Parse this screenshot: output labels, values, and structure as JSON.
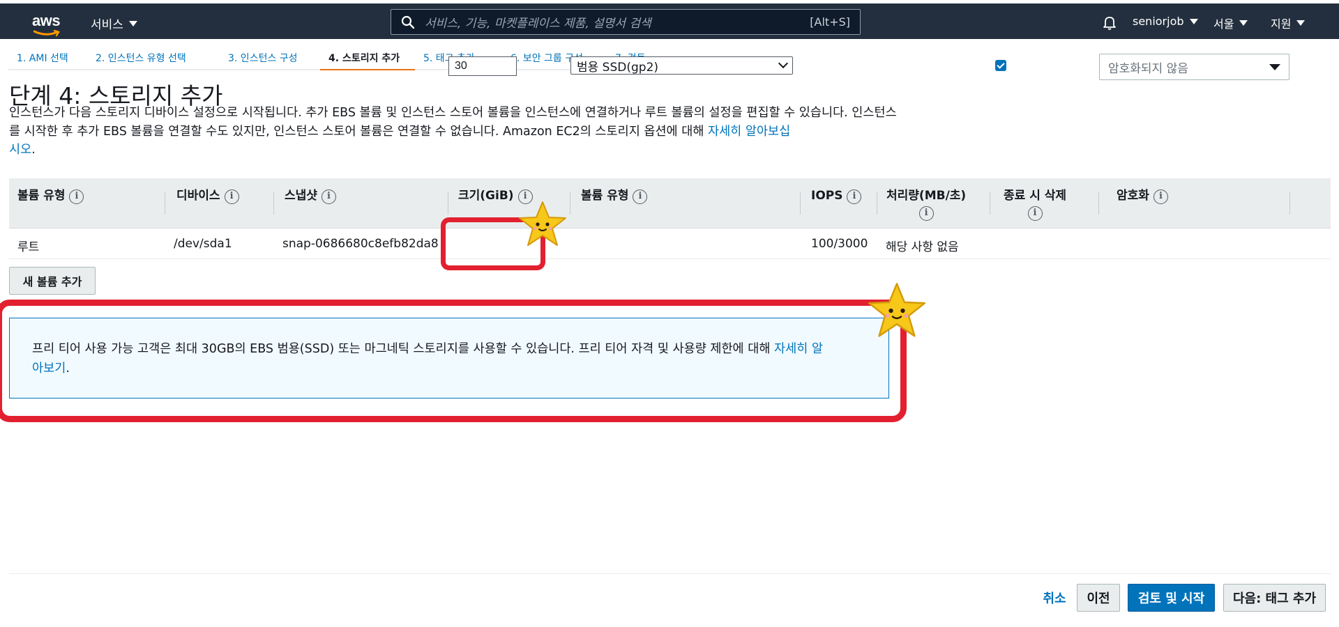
{
  "nav": {
    "logo_text": "aws",
    "services_label": "서비스",
    "search_placeholder": "서비스, 기능, 마켓플레이스 제품, 설명서 검색",
    "search_shortcut": "[Alt+S]",
    "account_label": "seniorjob",
    "region_label": "서울",
    "support_label": "지원"
  },
  "tabs": [
    {
      "label": "1. AMI 선택"
    },
    {
      "label": "2. 인스턴스 유형 선택"
    },
    {
      "label": "3. 인스턴스 구성"
    },
    {
      "label": "4. 스토리지 추가",
      "active": true
    },
    {
      "label": "5. 태그 추가"
    },
    {
      "label": "6. 보안 그룹 구성"
    },
    {
      "label": "7. 검토"
    }
  ],
  "page": {
    "title": "단계 4: 스토리지 추가",
    "description_line1": "인스턴스가 다음 스토리지 디바이스 설정으로 시작됩니다. 추가 EBS 볼륨 및 인스턴스 스토어 볼륨을 인스턴스에 연결하거나 루트 볼륨의 설정을 편집할 수 있습니",
    "description_line2": "다. 인스턴스를 시작한 후 추가 EBS 볼륨을 연결할 수도 있지만, 인스턴스 스토어 볼륨은 연결할 수 없습니다. Amazon EC2의 스토리지 옵션에 대해 ",
    "description_link_a": "자세히 알아보십",
    "description_link_b": "시오",
    "description_end": "."
  },
  "table": {
    "headers": {
      "volume_type": "볼륨 유형",
      "device": "디바이스",
      "snapshot": "스냅샷",
      "size": "크기(GiB)",
      "ebs_volume_type": "볼륨 유형",
      "iops": "IOPS",
      "throughput": "처리량(MB/초)",
      "delete_on_termination": "종료 시 삭제",
      "encryption": "암호화"
    },
    "row": {
      "volume_type": "루트",
      "device": "/dev/sda1",
      "snapshot": "snap-0686680c8efb82da8",
      "size": "30",
      "ebs_volume_type": "범용 SSD(gp2)",
      "iops": "100/3000",
      "throughput": "해당 사항 없음",
      "delete_on_termination": true,
      "encryption": "암호화되지 않음"
    }
  },
  "add_volume_label": "새 볼륨 추가",
  "info_box": {
    "text_line1": "프리 티어 사용 가능 고객은 최대 30GB의 EBS 범용(SSD) 또는 마그네틱 스토리지를 사용할 수 있습니다. 프리 티어 자격 및 사용량 제한에 대해 ",
    "link_a": "자세히 알",
    "link_b": "아보기",
    "end": "."
  },
  "footer": {
    "cancel_label": "취소",
    "prev_label": "이전",
    "review_label": "검토 및 시작",
    "next_label": "다음: 태그 추가"
  },
  "colors": {
    "nav_bg": "#232f3e",
    "link": "#0073bb",
    "active_tab": "#ec7211",
    "primary_button": "#0073bb",
    "annotation_red": "#e22030",
    "star_yellow": "#f7c719"
  }
}
